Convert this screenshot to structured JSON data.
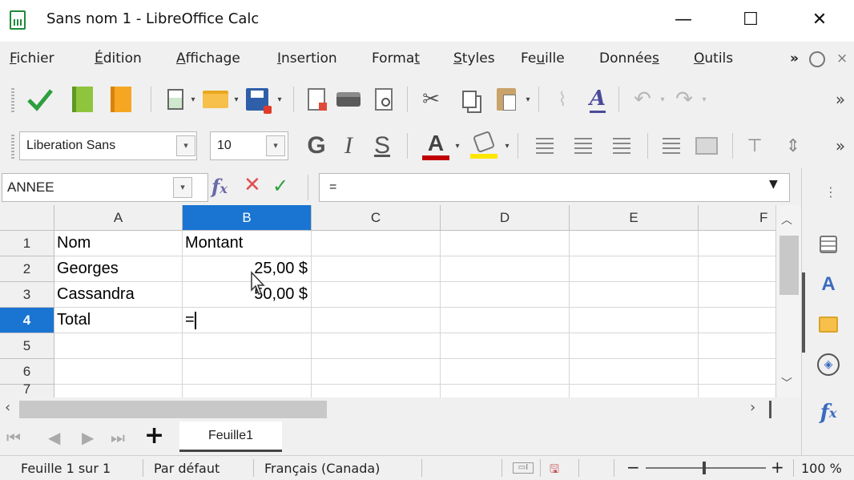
{
  "window": {
    "title": "Sans nom 1 - LibreOffice Calc",
    "minimize_glyph": "—",
    "maximize_glyph": "☐",
    "close_glyph": "✕"
  },
  "menu": {
    "items": [
      {
        "label_pre": "",
        "label_u": "F",
        "label_post": "ichier"
      },
      {
        "label_pre": "",
        "label_u": "É",
        "label_post": "dition"
      },
      {
        "label_pre": "",
        "label_u": "A",
        "label_post": "ffichage"
      },
      {
        "label_pre": "",
        "label_u": "I",
        "label_post": "nsertion"
      },
      {
        "label_pre": "Forma",
        "label_u": "t",
        "label_post": ""
      },
      {
        "label_pre": "",
        "label_u": "S",
        "label_post": "tyles"
      },
      {
        "label_pre": "Fe",
        "label_u": "u",
        "label_post": "ille"
      },
      {
        "label_pre": "Donnée",
        "label_u": "s",
        "label_post": ""
      },
      {
        "label_pre": "",
        "label_u": "O",
        "label_post": "utils"
      }
    ],
    "overflow": "»"
  },
  "format_toolbar": {
    "font_name": "Liberation Sans",
    "font_size": "10",
    "bold": "G",
    "italic": "I",
    "underline": "S",
    "font_color_letter": "A",
    "overflow": "»"
  },
  "formula_bar": {
    "name_box": "ANNEE",
    "input_value": "="
  },
  "grid": {
    "columns": [
      "A",
      "B",
      "C",
      "D",
      "E",
      "F"
    ],
    "active_column": "B",
    "rows": [
      "1",
      "2",
      "3",
      "4",
      "5",
      "6",
      "7"
    ],
    "active_row": "4",
    "cells": {
      "A1": "Nom",
      "B1": "Montant",
      "A2": "Georges",
      "B2": "25,00 $",
      "A3": "Cassandra",
      "B3": "50,00 $",
      "A4": "Total",
      "B4": "="
    }
  },
  "sheet_tabs": {
    "tabs": [
      "Feuille1"
    ],
    "add_glyph": "+"
  },
  "status_bar": {
    "sheet_info": "Feuille 1 sur 1",
    "page_style": "Par défaut",
    "language": "Français (Canada)",
    "zoom_minus": "−",
    "zoom_plus": "+",
    "zoom_level": "100 %"
  },
  "colors": {
    "accent": "#1a74d2",
    "accept_green": "#2e9e3e",
    "cancel_red": "#e05050",
    "font_color_red": "#c00000",
    "highlight_yellow": "#ffe600"
  }
}
